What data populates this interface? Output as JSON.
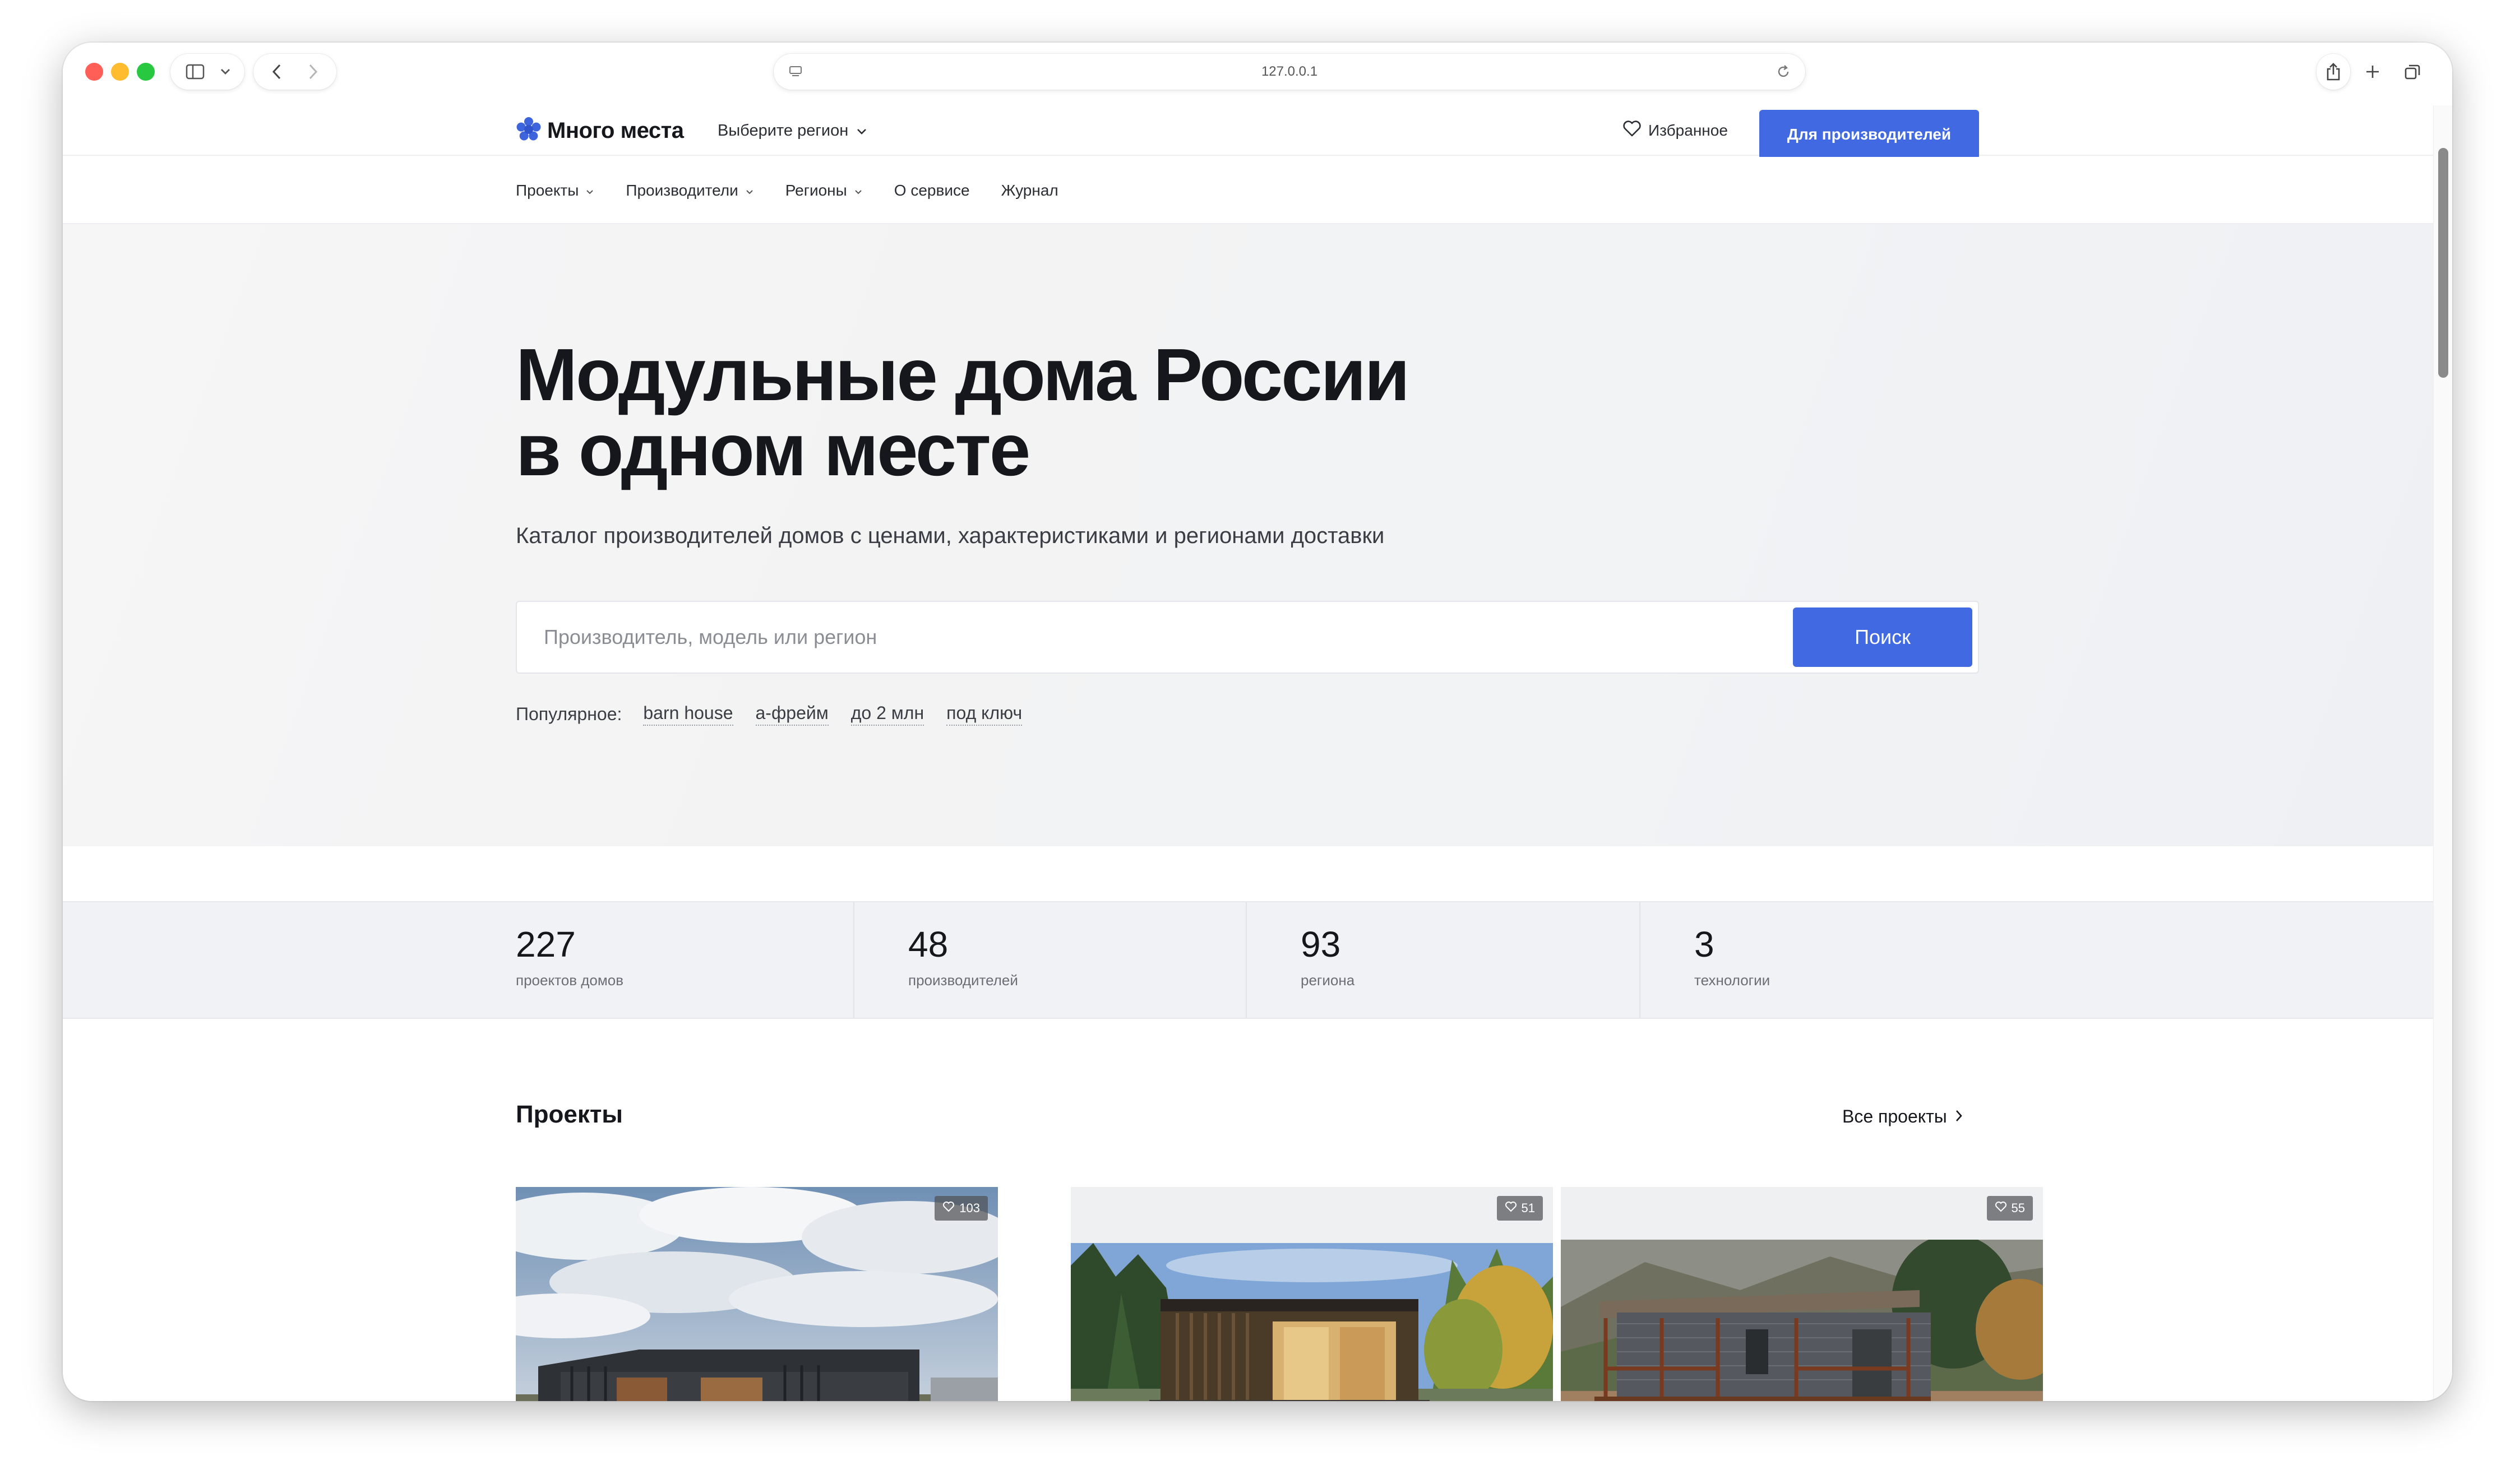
{
  "browser": {
    "url": "127.0.0.1"
  },
  "header": {
    "logo_text": "Много места",
    "region_label": "Выберите регион",
    "favorites_label": "Избранное",
    "cta_label": "Для производителей",
    "brand_color": "#4169e1"
  },
  "subnav": {
    "items": [
      {
        "label": "Проекты",
        "dropdown": true
      },
      {
        "label": "Производители",
        "dropdown": true
      },
      {
        "label": "Регионы",
        "dropdown": true
      },
      {
        "label": "О сервисе",
        "dropdown": false
      },
      {
        "label": "Журнал",
        "dropdown": false
      }
    ]
  },
  "hero": {
    "title_line1": "Модульные дома России",
    "title_line2": "в одном месте",
    "subtitle": "Каталог производителей домов с ценами, характеристиками и регионами доставки",
    "search_placeholder": "Производитель, модель или регион",
    "search_button": "Поиск",
    "popular_label": "Популярное:",
    "popular_tags": [
      "barn house",
      "а-фрейм",
      "до 2 млн",
      "под ключ"
    ]
  },
  "stats": [
    {
      "value": "227",
      "label": "проектов домов"
    },
    {
      "value": "48",
      "label": "производителей"
    },
    {
      "value": "93",
      "label": "региона"
    },
    {
      "value": "3",
      "label": "технологии"
    }
  ],
  "projects": {
    "title": "Проекты",
    "all_link": "Все проекты",
    "cards": [
      {
        "likes": "103",
        "image": "house-photo-cloudy-sky"
      },
      {
        "likes": "51",
        "image": "house-photo-forest"
      },
      {
        "likes": "55",
        "image": "house-photo-mountains"
      }
    ]
  }
}
